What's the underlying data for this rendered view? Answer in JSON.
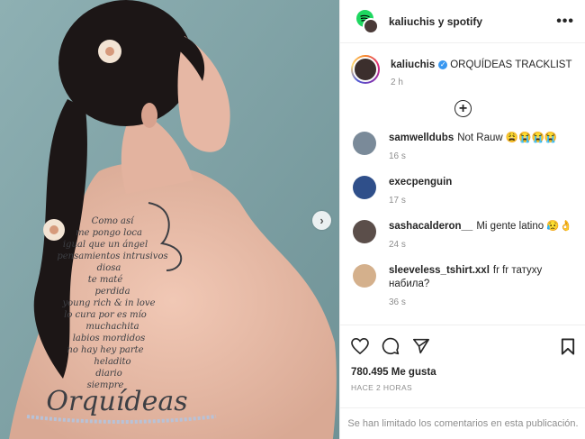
{
  "header": {
    "title": "kaliuchis y spotify",
    "more_label": "•••"
  },
  "caption": {
    "username": "kaliuchis",
    "verified_mark": "✓",
    "text": "ORQUÍDEAS TRACKLIST",
    "time": "2 h"
  },
  "load_more_label": "+",
  "comments": [
    {
      "username": "samwelldubs",
      "text": "Not Rauw 😩😭😭😭",
      "time": "16 s",
      "avatar_color": "#7a8a99"
    },
    {
      "username": "execpenguin",
      "text": "",
      "time": "17 s",
      "avatar_color": "#2f4f8a"
    },
    {
      "username": "sashacalderon__",
      "text": "Mi gente latino 😥👌",
      "time": "24 s",
      "avatar_color": "#5b4e4a"
    },
    {
      "username": "sleeveless_tshirt.xxl",
      "text": "fr fr татуху набила?",
      "time": "36 s",
      "avatar_color": "#d4b08c"
    }
  ],
  "likes": "780.495 Me gusta",
  "posted_ago": "Hace 2 horas",
  "comments_limited": "Se han limitado los comentarios en esta publicación.",
  "tattoo_lines": [
    "Como así",
    "me pongo loca",
    "igual que un ángel",
    "pensamientos intrusivos",
    "diosa",
    "te maté",
    "perdida",
    "young rich & in love",
    "lo cura por es mío",
    "muchachita",
    "labios mordidos",
    "no hay hey parte",
    "heladito",
    "diario",
    "siempre"
  ],
  "tattoo_title": "Orquídeas",
  "colors": {
    "accent_blue": "#3897f0",
    "spotify_green": "#1ed760",
    "media_bg": "#86a5a8"
  }
}
